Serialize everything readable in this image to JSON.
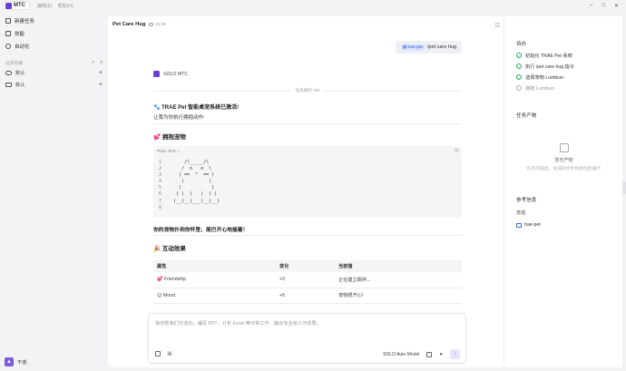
{
  "topbar": {
    "brand": "MTC",
    "menus": [
      "编辑(E)",
      "帮助(H)"
    ],
    "window_controls": [
      "minimize-icon",
      "maximize-icon",
      "close-icon"
    ]
  },
  "sidebar": {
    "items": [
      {
        "label": "新建任务",
        "icon": "new-task-icon"
      },
      {
        "label": "技能",
        "icon": "skills-icon"
      },
      {
        "label": "自动化",
        "icon": "automation-icon"
      }
    ],
    "section_title": "任务列表",
    "projects": [
      {
        "label": "默认",
        "icon": "cloud-icon"
      },
      {
        "label": "默认",
        "icon": "folder-icon"
      }
    ],
    "user": {
      "avatar_letter": "▲",
      "name": "不惑."
    }
  },
  "chat": {
    "title": "Pet Care Hug",
    "time": "15:36",
    "user_message": {
      "chip": "trae-pet",
      "text": "/pet care hug"
    },
    "agent_name": "SOLO MTC",
    "divider_label": "任务耗时 19s",
    "line1": "🐾 TRAE Pet 智能桌宠系统已激活!",
    "line2": "让我为你执行拥抱动作:",
    "section1_title": "💕 拥抱宠物",
    "code": {
      "lang": "Plain Text",
      "lines": [
        {
          "n": "1",
          "text": "    /\\_____/\\"
        },
        {
          "n": "2",
          "text": "   /  o   o  \\"
        },
        {
          "n": "3",
          "text": "  ( ==  ^  == )"
        },
        {
          "n": "4",
          "text": "   )         ("
        },
        {
          "n": "5",
          "text": "  (           )"
        },
        {
          "n": "6",
          "text": " ( (  )   (  ) )"
        },
        {
          "n": "7",
          "text": "(__(__)___(__)__)"
        },
        {
          "n": "8",
          "text": ""
        }
      ]
    },
    "note": "你的宠物扑到你怀里，尾巴开心地摇着！",
    "section2_title": "🎉 互动效果",
    "table": {
      "headers": [
        "属性",
        "变化",
        "当前值"
      ],
      "rows": [
        [
          "💕 Friendship",
          "+3",
          "正在建立羁绊..."
        ],
        [
          "😊 Mood",
          "+5",
          "宠物很开心!"
        ]
      ]
    },
    "composer": {
      "placeholder": "我你帮我们交流功，编写 PPT，分析 Excel 等日常工作，输出专业级工作成果。",
      "model": "SOLO Auto Model",
      "send": "↑"
    }
  },
  "right_panel": {
    "todo_title": "待办",
    "todos": [
      {
        "label": "初始化 TRAE Pet 系统",
        "done": true
      },
      {
        "label": "执行 /pet care hug 指令",
        "done": true
      },
      {
        "label": "选择宠物 Lumibun",
        "done": true
      },
      {
        "label": "拥抱 Lumibun",
        "done": false
      }
    ],
    "artifacts_title": "任务产物",
    "empty_title": "暂无产物",
    "empty_desc": "任务完成后，生成的文件将会在此展示",
    "ref_title": "参考信息",
    "ref_sub": "技能",
    "ref_link": "trae-pet"
  }
}
